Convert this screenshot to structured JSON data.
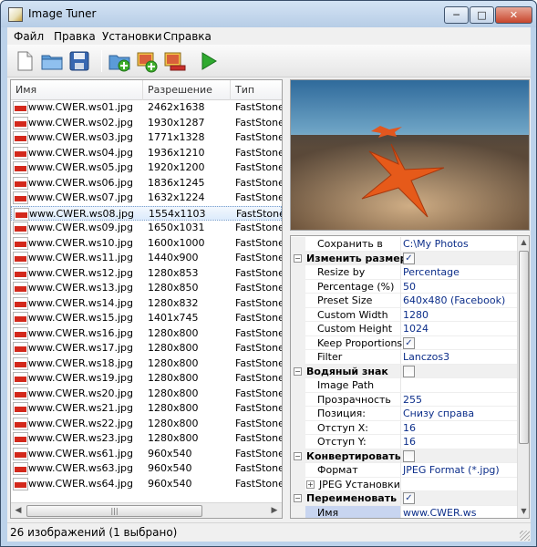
{
  "window": {
    "title": "Image Tuner",
    "minimize": "─",
    "maximize": "□",
    "close": "✕"
  },
  "menu": [
    "Файл",
    "Правка",
    "Установки",
    "Справка"
  ],
  "toolbar": {
    "icons": [
      "new-file-icon",
      "open-folder-icon",
      "save-disk-icon",
      "add-folder-icon",
      "add-images-icon",
      "remove-images-icon",
      "run-play-icon"
    ]
  },
  "file_list": {
    "columns": [
      "Имя",
      "Разрешение",
      "Тип"
    ],
    "rows": [
      [
        "www.CWER.ws01.jpg",
        "2462x1638",
        "FastStone"
      ],
      [
        "www.CWER.ws02.jpg",
        "1930x1287",
        "FastStone"
      ],
      [
        "www.CWER.ws03.jpg",
        "1771x1328",
        "FastStone"
      ],
      [
        "www.CWER.ws04.jpg",
        "1936x1210",
        "FastStone"
      ],
      [
        "www.CWER.ws05.jpg",
        "1920x1200",
        "FastStone"
      ],
      [
        "www.CWER.ws06.jpg",
        "1836x1245",
        "FastStone"
      ],
      [
        "www.CWER.ws07.jpg",
        "1632x1224",
        "FastStone"
      ],
      [
        "www.CWER.ws08.jpg",
        "1554x1103",
        "FastStone"
      ],
      [
        "www.CWER.ws09.jpg",
        "1650x1031",
        "FastStone"
      ],
      [
        "www.CWER.ws10.jpg",
        "1600x1000",
        "FastStone"
      ],
      [
        "www.CWER.ws11.jpg",
        "1440x900",
        "FastStone"
      ],
      [
        "www.CWER.ws12.jpg",
        "1280x853",
        "FastStone"
      ],
      [
        "www.CWER.ws13.jpg",
        "1280x850",
        "FastStone"
      ],
      [
        "www.CWER.ws14.jpg",
        "1280x832",
        "FastStone"
      ],
      [
        "www.CWER.ws15.jpg",
        "1401x745",
        "FastStone"
      ],
      [
        "www.CWER.ws16.jpg",
        "1280x800",
        "FastStone"
      ],
      [
        "www.CWER.ws17.jpg",
        "1280x800",
        "FastStone"
      ],
      [
        "www.CWER.ws18.jpg",
        "1280x800",
        "FastStone"
      ],
      [
        "www.CWER.ws19.jpg",
        "1280x800",
        "FastStone"
      ],
      [
        "www.CWER.ws20.jpg",
        "1280x800",
        "FastStone"
      ],
      [
        "www.CWER.ws21.jpg",
        "1280x800",
        "FastStone"
      ],
      [
        "www.CWER.ws22.jpg",
        "1280x800",
        "FastStone"
      ],
      [
        "www.CWER.ws23.jpg",
        "1280x800",
        "FastStone"
      ],
      [
        "www.CWER.ws61.jpg",
        "960x540",
        "FastStone"
      ],
      [
        "www.CWER.ws63.jpg",
        "960x540",
        "FastStone"
      ],
      [
        "www.CWER.ws64.jpg",
        "960x540",
        "FastStone"
      ]
    ],
    "selected_index": 7
  },
  "properties": [
    {
      "kind": "prop",
      "label": "Сохранить в",
      "value": "C:\\My Photos"
    },
    {
      "kind": "cat",
      "label": "Изменить размер",
      "checked": true
    },
    {
      "kind": "prop",
      "label": "Resize by",
      "value": "Percentage"
    },
    {
      "kind": "prop",
      "label": "Percentage (%)",
      "value": "50"
    },
    {
      "kind": "prop",
      "label": "Preset Size",
      "value": "640x480 (Facebook)"
    },
    {
      "kind": "prop",
      "label": "Custom Width",
      "value": "1280"
    },
    {
      "kind": "prop",
      "label": "Custom Height",
      "value": "1024"
    },
    {
      "kind": "check",
      "label": "Keep Proportions",
      "checked": true
    },
    {
      "kind": "prop",
      "label": "Filter",
      "value": "Lanczos3"
    },
    {
      "kind": "cat",
      "label": "Водяный знак",
      "checked": false
    },
    {
      "kind": "prop",
      "label": "Image Path",
      "value": ""
    },
    {
      "kind": "prop",
      "label": "Прозрачность",
      "value": "255"
    },
    {
      "kind": "prop",
      "label": "Позиция:",
      "value": "Снизу справа"
    },
    {
      "kind": "prop",
      "label": "Отступ X:",
      "value": "16"
    },
    {
      "kind": "prop",
      "label": "Отступ Y:",
      "value": "16"
    },
    {
      "kind": "cat",
      "label": "Конвертировать",
      "checked": false
    },
    {
      "kind": "prop",
      "label": "Формат",
      "value": "JPEG Format (*.jpg)"
    },
    {
      "kind": "sub",
      "label": "JPEG Установки",
      "value": ""
    },
    {
      "kind": "cat",
      "label": "Переименовать",
      "checked": true
    },
    {
      "kind": "hl",
      "label": "Имя",
      "value": "www.CWER.ws"
    }
  ],
  "status": "26 изображений (1 выбрано)",
  "colors": {
    "accent": "#0c2e8a",
    "selection": "#dcebfc",
    "jpg_badge": "#d3281b"
  }
}
